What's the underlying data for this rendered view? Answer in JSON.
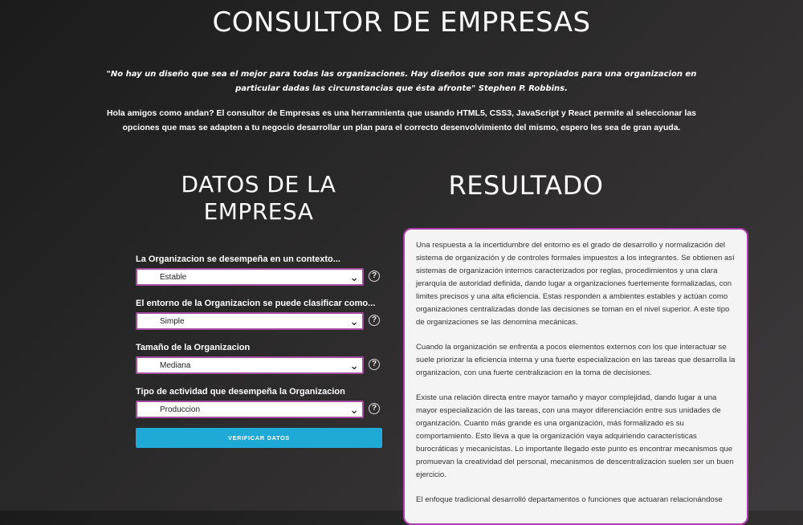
{
  "header": {
    "title": "CONSULTOR DE EMPRESAS",
    "quote": "\"No hay un diseño que sea el mejor para todas las organizaciones. Hay diseños que son mas apropiados para una organizacion en particular dadas las circunstancias que ésta afronte\" Stephen P. Robbins.",
    "intro": "Hola amigos como andan? El consultor de Empresas es una herramnienta que usando HTML5, CSS3, JavaScript y React permite al seleccionar las opciones que mas se adapten a tu negocio desarrollar un plan para el correcto desenvolvimiento del mismo, espero les sea de gran ayuda."
  },
  "form": {
    "title_line1": "DATOS DE LA",
    "title_line2": "EMPRESA",
    "fields": [
      {
        "label": "La Organizacion se desempeña en un contexto...",
        "value": "Estable"
      },
      {
        "label": "El entorno de la Organizacion se puede clasificar como...",
        "value": "Simple"
      },
      {
        "label": "Tamaño de la Organizacion",
        "value": "Mediana"
      },
      {
        "label": "Tipo de actividad que desempeña la Organizacion",
        "value": "Produccion"
      }
    ],
    "help_glyph": "?",
    "verify_label": "VERIFICAR DATOS"
  },
  "result": {
    "title": "RESULTADO",
    "paragraphs": [
      "Una respuesta a la incertidumbre del entorno es el grado de desarrollo y normalización del sistema de organización y de controles formales impuestos a los integrantes. Se obtienen así sistemas de organización internos caracterizados por reglas, procedimientos y una clara jerarquía de autoridad definida, dando lugar a organizaciones fuertemente formalizadas, con limites precisos y una alta eficiencia. Estas responden a ambientes estables y actúan como organizaciones centralizadas donde las decisiones se toman en el nivel superior. A este tipo de organizaciones se las denomina mecánicas.",
      "Cuando la organización se enfrenta a pocos elementos externos con los que interactuar se suele priorizar la eficiencia interna y una fuerte especializacion en las tareas que desarrolla la organizacion, con una fuerte centralizacion en la toma de decisiones.",
      "Existe una relación directa entre mayor tamaño y mayor complejidad, dando lugar a una mayor especialización de las tareas, con una mayor diferenciación entre sus unidades de organización. Cuanto más grande es una organización, más formalizado es su comportamiento. Esto lleva a que la organización vaya adquiriendo características burocráticas y mecanicistas. Lo importante llegado este punto es encontrar mecanismos que promuevan la creatividad del personal, mecanismos de descentralizacion suelen ser un buen ejercicio.",
      "El enfoque tradicional desarrolló departamentos o funciones que actuaran relacionándose"
    ]
  },
  "colors": {
    "accent_border": "#a64fa0",
    "button": "#1ea9d6"
  },
  "icons": {
    "select_arrow": "chevron-down-icon",
    "help": "help-icon"
  }
}
